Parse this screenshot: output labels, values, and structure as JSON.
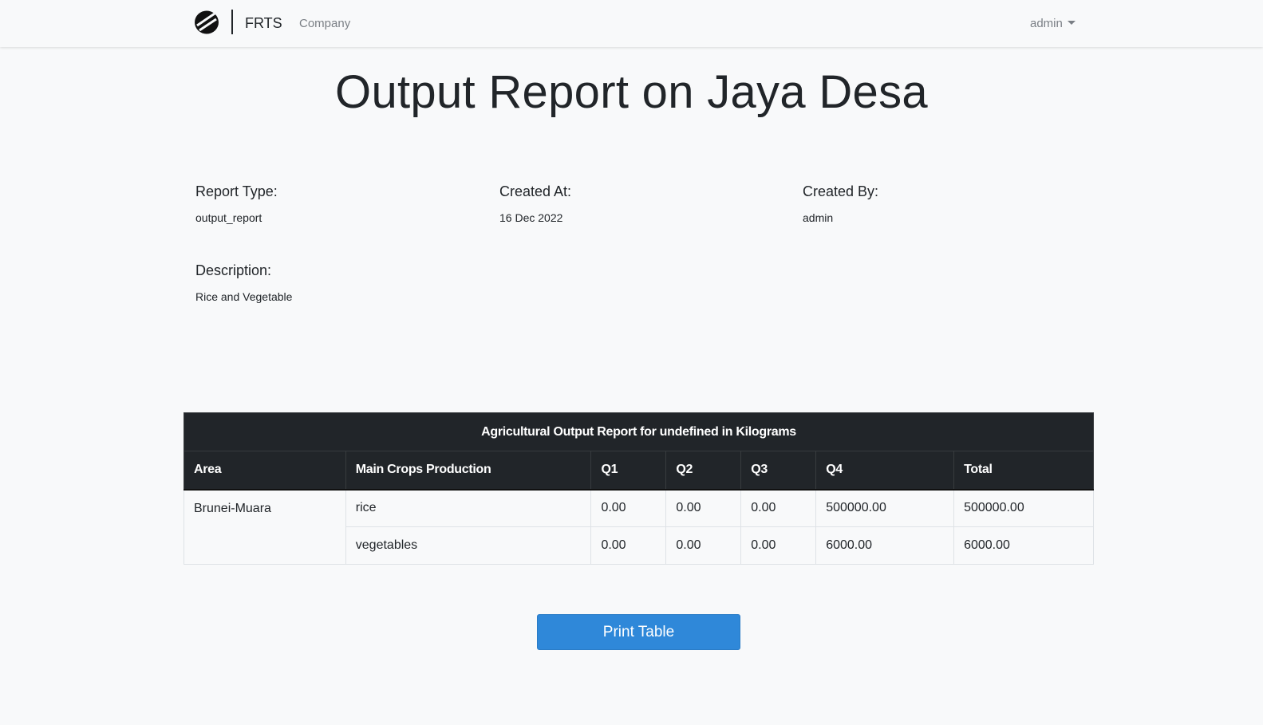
{
  "navbar": {
    "brand": "FRTS",
    "company_link": "Company",
    "user_menu": "admin",
    "logo_icon": "brand-logo-icon",
    "caret_icon": "caret-down-icon"
  },
  "page": {
    "title": "Output Report on Jaya Desa"
  },
  "meta": {
    "report_type_label": "Report Type:",
    "report_type_value": "output_report",
    "created_at_label": "Created At:",
    "created_at_value": "16 Dec 2022",
    "created_by_label": "Created By:",
    "created_by_value": "admin",
    "description_label": "Description:",
    "description_value": "Rice and Vegetable"
  },
  "table": {
    "caption": "Agricultural Output Report for undefined in Kilograms",
    "headers": [
      "Area",
      "Main Crops Production",
      "Q1",
      "Q2",
      "Q3",
      "Q4",
      "Total"
    ],
    "area": "Brunei-Muara",
    "rows": [
      {
        "crop": "rice",
        "q1": "0.00",
        "q2": "0.00",
        "q3": "0.00",
        "q4": "500000.00",
        "total": "500000.00"
      },
      {
        "crop": "vegetables",
        "q1": "0.00",
        "q2": "0.00",
        "q3": "0.00",
        "q4": "6000.00",
        "total": "6000.00"
      }
    ]
  },
  "actions": {
    "print_label": "Print Table"
  },
  "colors": {
    "table_header_bg": "#212529",
    "button_bg": "#2f88d9",
    "page_bg": "#f8f9fa"
  }
}
